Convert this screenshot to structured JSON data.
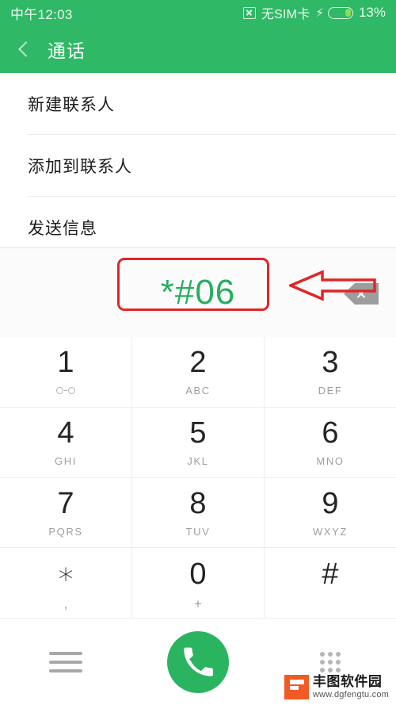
{
  "colors": {
    "header_green": "#2FB865",
    "dial_green": "#27AE60",
    "call_button_green": "#2BB45F",
    "annotation_red": "#e02626",
    "watermark_orange": "#F15A22"
  },
  "statusbar": {
    "time": "中午12:03",
    "no_signal_icon": "no-signal-icon",
    "sim_status": "无SIM卡",
    "charging_icon": "lightning-bolt-icon",
    "battery_icon": "battery-icon",
    "battery_percent": "13%"
  },
  "header": {
    "back_icon": "chevron-left-icon",
    "title": "通话"
  },
  "menu": {
    "items": [
      {
        "label": "新建联系人"
      },
      {
        "label": "添加到联系人"
      },
      {
        "label": "发送信息"
      }
    ]
  },
  "dial": {
    "number": "*#06",
    "backspace_icon": "backspace-delete-icon"
  },
  "annotations": {
    "highlight_box": "red-rectangle-highlight",
    "arrow": "red-left-arrow"
  },
  "keypad": {
    "rows": [
      [
        {
          "digit": "1",
          "sub": "",
          "sub_icon": "voicemail-icon"
        },
        {
          "digit": "2",
          "sub": "ABC",
          "sub_icon": ""
        },
        {
          "digit": "3",
          "sub": "DEF",
          "sub_icon": ""
        }
      ],
      [
        {
          "digit": "4",
          "sub": "GHI",
          "sub_icon": ""
        },
        {
          "digit": "5",
          "sub": "JKL",
          "sub_icon": ""
        },
        {
          "digit": "6",
          "sub": "MNO",
          "sub_icon": ""
        }
      ],
      [
        {
          "digit": "7",
          "sub": "PQRS",
          "sub_icon": ""
        },
        {
          "digit": "8",
          "sub": "TUV",
          "sub_icon": ""
        },
        {
          "digit": "9",
          "sub": "WXYZ",
          "sub_icon": ""
        }
      ],
      [
        {
          "digit": "∗",
          "sub": ",",
          "sub_icon": ""
        },
        {
          "digit": "0",
          "sub": "+",
          "sub_icon": ""
        },
        {
          "digit": "#",
          "sub": "",
          "sub_icon": ""
        }
      ]
    ]
  },
  "bottombar": {
    "menu_icon": "hamburger-menu-icon",
    "call_icon": "phone-call-icon",
    "keypad_icon": "dialpad-dots-icon"
  },
  "watermark": {
    "logo_icon": "fengtu-logo-icon",
    "name": "丰图软件园",
    "url": "www.dgfengtu.com"
  }
}
